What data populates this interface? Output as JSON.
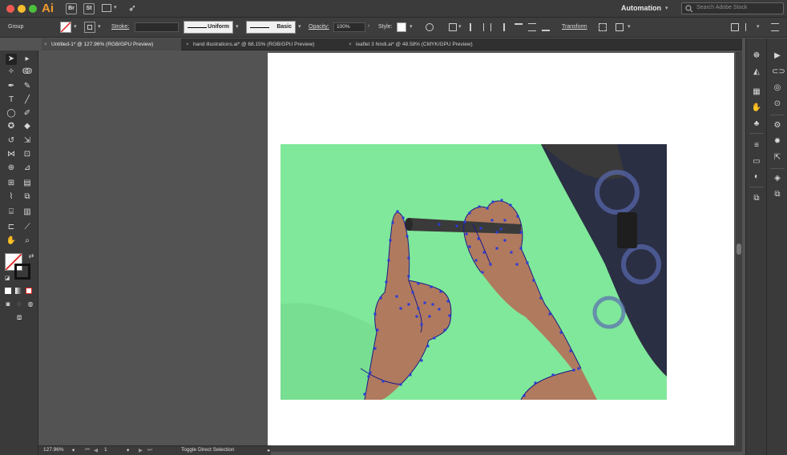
{
  "app": {
    "logo": "Ai",
    "bridge_label": "Br",
    "stock_label": "St",
    "workspace": "Automation",
    "search_placeholder": "Search Adobe Stock"
  },
  "control": {
    "selection_type": "Group",
    "stroke_label": "Stroke:",
    "profile": "Uniform",
    "brush": "Basic",
    "opacity_label": "Opacity:",
    "opacity_value": "100%",
    "style_label": "Style:",
    "transform_label": "Transform"
  },
  "tabs": [
    {
      "label": "Untitled-1* @ 127.96% (RGB/GPU Preview)"
    },
    {
      "label": "hand illustrations.ai* @ 68.15% (RGB/GPU Preview)"
    },
    {
      "label": "leaflet 3 hindi.ai* @ 48.58% (CMYK/GPU Preview)"
    }
  ],
  "status": {
    "zoom": "127.96%",
    "artboard": "1",
    "current_tool": "Toggle Direct Selection"
  },
  "colors": {
    "app_bar": "#3b3b3b",
    "accent_logo": "#f29a2e",
    "greenscreen": "#80e89a",
    "path_blue": "#2a3ad8"
  },
  "icons": {
    "search": "search-icon",
    "selection": "selection-tool-icon",
    "direct_selection": "direct-selection-tool-icon",
    "hand": "hand-tool-icon",
    "zoom": "zoom-tool-icon"
  }
}
